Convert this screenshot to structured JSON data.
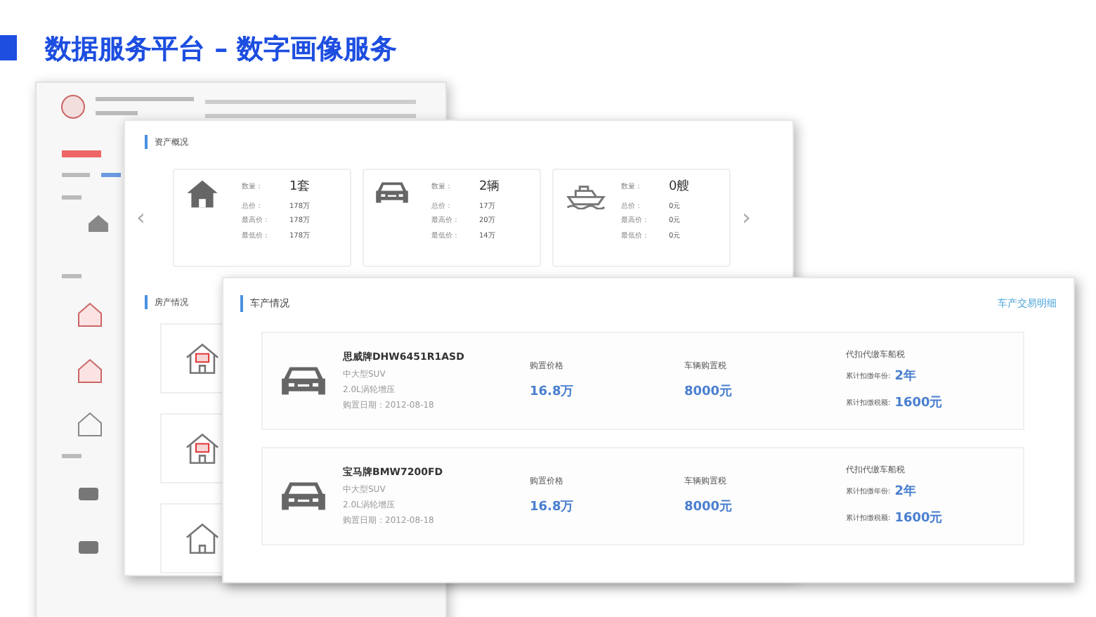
{
  "title": "数据服务平台 – 数字画像服务",
  "asset_panel": {
    "heading": "资产概况",
    "prev_arrow": "‹",
    "next_arrow": "›",
    "cards": [
      {
        "kind": "house",
        "rows": [
          {
            "label": "数量：",
            "value": "1套"
          },
          {
            "label": "总价：",
            "value": "178万"
          },
          {
            "label": "最高价：",
            "value": "178万"
          },
          {
            "label": "最低价：",
            "value": "178万"
          }
        ]
      },
      {
        "kind": "car",
        "rows": [
          {
            "label": "数量：",
            "value": "2辆"
          },
          {
            "label": "总价：",
            "value": "17万"
          },
          {
            "label": "最高价：",
            "value": "20万"
          },
          {
            "label": "最低价：",
            "value": "14万"
          }
        ]
      },
      {
        "kind": "boat",
        "rows": [
          {
            "label": "数量：",
            "value": "0艘"
          },
          {
            "label": "总价：",
            "value": "0元"
          },
          {
            "label": "最高价：",
            "value": "0元"
          },
          {
            "label": "最低价：",
            "value": "0元"
          }
        ]
      }
    ]
  },
  "house_panel": {
    "heading": "房产情况",
    "houses": [
      {
        "kind": "marked"
      },
      {
        "kind": "marked"
      },
      {
        "kind": "plain"
      }
    ]
  },
  "vehicle_panel": {
    "heading": "车产情况",
    "link": "车产交易明细",
    "vehicles": [
      {
        "name": "思威牌DHW6451R1ASD",
        "type": "中大型SUV",
        "engine": "2.0L涡轮增压",
        "date": "购置日期：2012-08-18",
        "price_label": "购置价格",
        "price": "16.8万",
        "tax_label": "车辆购置税",
        "tax": "8000元",
        "vessel_label": "代扣代缴车船税",
        "years_label": "累计扣缴年份:",
        "years": "2年",
        "amount_label": "累计扣缴税额:",
        "amount": "1600元"
      },
      {
        "name": "宝马牌BMW7200FD",
        "type": "中大型SUV",
        "engine": "2.0L涡轮增压",
        "date": "购置日期：2012-08-18",
        "price_label": "购置价格",
        "price": "16.8万",
        "tax_label": "车辆购置税",
        "tax": "8000元",
        "vessel_label": "代扣代缴车船税",
        "years_label": "累计扣缴年份:",
        "years": "2年",
        "amount_label": "累计扣缴税额:",
        "amount": "1600元"
      }
    ]
  }
}
